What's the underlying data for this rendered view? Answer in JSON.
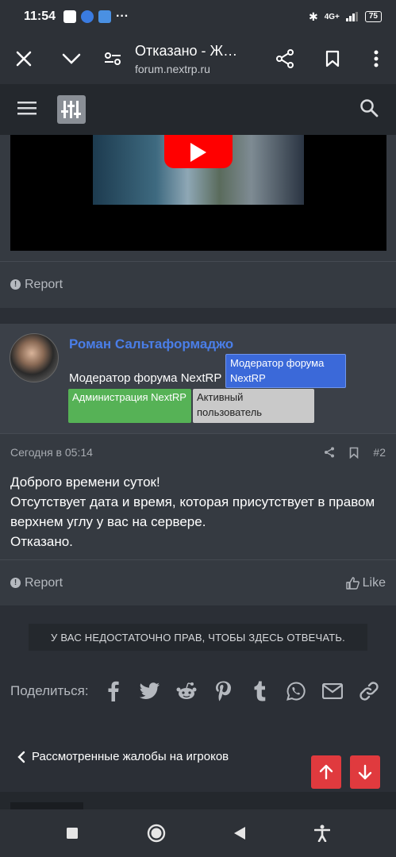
{
  "statusbar": {
    "time": "11:54",
    "dots": "···",
    "network": "4G+",
    "battery": "75"
  },
  "browser": {
    "title": "Отказано - Ж…",
    "host": "forum.nextrp.ru"
  },
  "post1": {
    "report_label": "Report"
  },
  "post2": {
    "author_name": "Роман Сальтаформаджо",
    "author_title": "Модератор форума NextRP",
    "badges": [
      "Модератор форума NextRP",
      "Администрация NextRP",
      "Активный пользователь"
    ],
    "date": "Сегодня в 05:14",
    "number": "#2",
    "message_lines": [
      "Доброго времени суток!",
      "Отсутствует дата и время, которая присутствует в правом верхнем углу у вас на сервере.",
      "Отказано."
    ],
    "report_label": "Report",
    "like_label": "Like"
  },
  "no_permission": "У ВАС НЕДОСТАТОЧНО ПРАВ, ЧТОБЫ ЗДЕСЬ ОТВЕЧАТЬ.",
  "share": {
    "label": "Поделиться:",
    "icons": [
      "facebook-icon",
      "twitter-icon",
      "reddit-icon",
      "pinterest-icon",
      "tumblr-icon",
      "whatsapp-icon",
      "email-icon",
      "link-icon"
    ]
  },
  "back_link": "Рассмотренные жалобы на игроков",
  "colors": {
    "accent_red": "#e03a3e",
    "username_blue": "#4a7ee8",
    "badge_mod": "#3b69d9",
    "badge_admin": "#56b256",
    "badge_active": "#c9c9c9"
  }
}
